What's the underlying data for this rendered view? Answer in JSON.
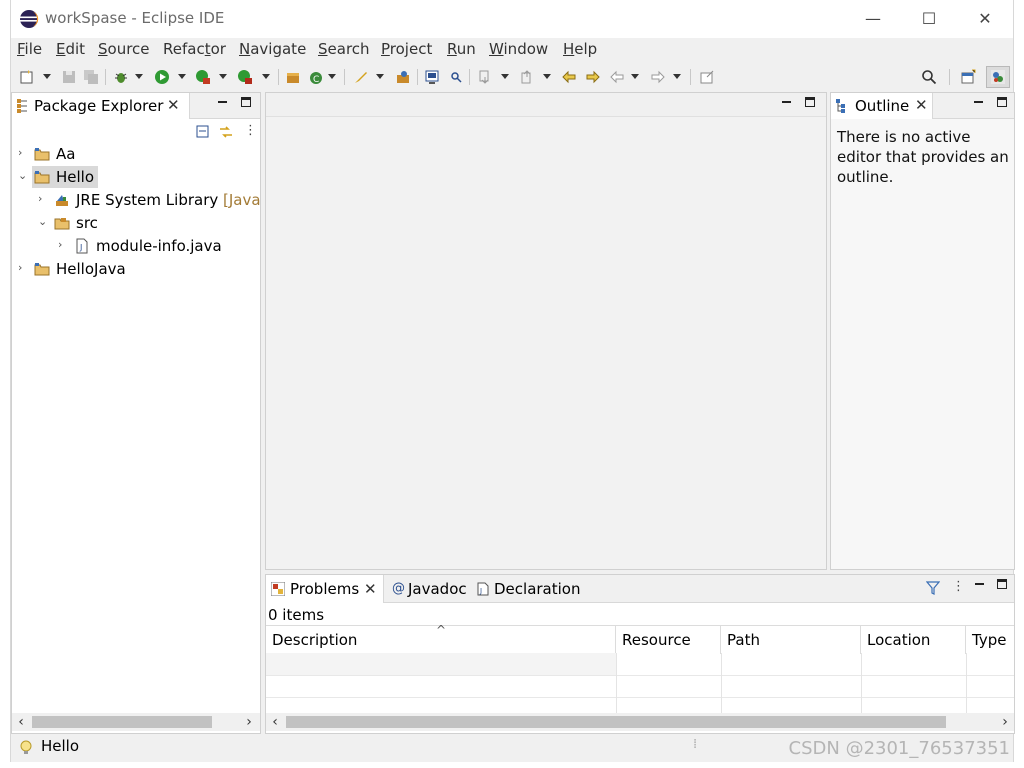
{
  "window": {
    "title": "workSpase - Eclipse IDE",
    "controls": {
      "minimize": "—",
      "maximize": "☐",
      "close": "✕"
    }
  },
  "menu": [
    {
      "key": "F",
      "rest": "ile"
    },
    {
      "key": "E",
      "rest": "dit"
    },
    {
      "key": "S",
      "rest": "ource"
    },
    {
      "pre": "Refac",
      "key": "t",
      "rest": "or"
    },
    {
      "key": "N",
      "rest": "avigate"
    },
    {
      "key": "S",
      "rest": "earch",
      "pre_only": true
    },
    {
      "key": "P",
      "rest": "roject"
    },
    {
      "key": "R",
      "rest": "un"
    },
    {
      "key": "W",
      "rest": "indow"
    },
    {
      "key": "H",
      "rest": "elp"
    }
  ],
  "package_explorer": {
    "tab_label": "Package Explorer",
    "close": "✕",
    "tree": [
      {
        "label": "Aa",
        "twisty": "›",
        "icon": "project-icon",
        "depth": 0
      },
      {
        "label": "Hello",
        "twisty": "⌄",
        "icon": "project-icon",
        "depth": 0,
        "selected": true
      },
      {
        "label": "JRE System Library",
        "suffix": "[JavaSE",
        "twisty": "›",
        "icon": "library-icon",
        "depth": 1
      },
      {
        "label": "src",
        "twisty": "⌄",
        "icon": "package-folder-icon",
        "depth": 1
      },
      {
        "label": "module-info.java",
        "twisty": "›",
        "icon": "java-file-icon",
        "depth": 2
      },
      {
        "label": "HelloJava",
        "twisty": "›",
        "icon": "project-icon",
        "depth": 0
      }
    ]
  },
  "outline": {
    "tab_label": "Outline",
    "close": "✕",
    "message": "There is no active editor that provides an outline."
  },
  "bottom_panel": {
    "tabs": [
      {
        "label": "Problems",
        "icon": "problems-icon",
        "active": true,
        "close": "✕"
      },
      {
        "label": "Javadoc",
        "icon": "javadoc-icon",
        "glyph": "@"
      },
      {
        "label": "Declaration",
        "icon": "declaration-icon"
      }
    ],
    "items_count": "0 items",
    "sort_indicator": "^",
    "columns": [
      "Description",
      "Resource",
      "Path",
      "Location",
      "Type"
    ]
  },
  "status": {
    "selection": "Hello"
  },
  "watermark": "CSDN @2301_76537351",
  "colors": {
    "chrome_bg": "#f0f0f0",
    "accent_blue": "#1f5fbf",
    "library_suffix": "#a37b36"
  }
}
